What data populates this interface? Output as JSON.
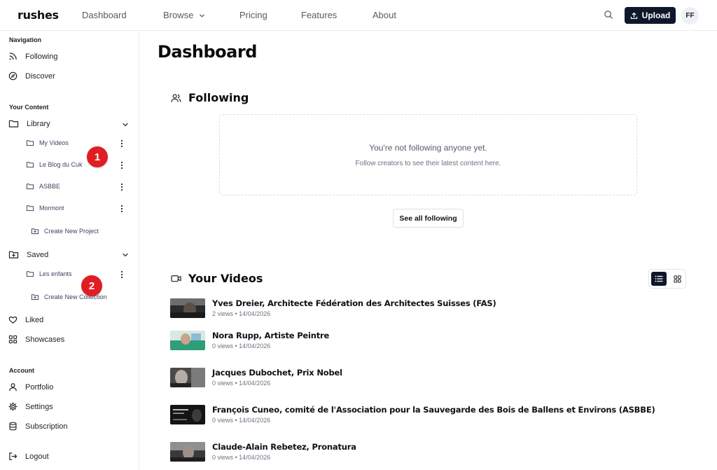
{
  "topbar": {
    "logo": "rushes",
    "nav": [
      "Dashboard",
      "Browse",
      "Pricing",
      "Features",
      "About"
    ],
    "upload_label": "Upload",
    "avatar_initials": "FF"
  },
  "sidebar": {
    "navigation_label": "Navigation",
    "navigation_items": [
      "Following",
      "Discover"
    ],
    "content_label": "Your Content",
    "library_label": "Library",
    "library_items": [
      "My Videos",
      "Le Blog du Cuk",
      "ASBBE",
      "Mormont"
    ],
    "create_project_label": "Create New Project",
    "saved_label": "Saved",
    "saved_items": [
      "Les enfants"
    ],
    "create_collection_label": "Create New Collection",
    "liked_label": "Liked",
    "showcases_label": "Showcases",
    "account_label": "Account",
    "account_items": [
      "Portfolio",
      "Settings",
      "Subscription"
    ],
    "logout_label": "Logout",
    "badges": [
      "1",
      "2"
    ]
  },
  "main": {
    "title": "Dashboard",
    "following": {
      "title": "Following",
      "empty_title": "You're not following anyone yet.",
      "empty_sub": "Follow creators to see their latest content here.",
      "see_all_label": "See all following"
    },
    "videos": {
      "title": "Your Videos",
      "items": [
        {
          "title": "Yves Dreier, Architecte Fédération des Architectes Suisses (FAS)",
          "meta": "2 views • 14/04/2026"
        },
        {
          "title": "Nora Rupp, Artiste Peintre",
          "meta": "0 views • 14/04/2026"
        },
        {
          "title": "Jacques Dubochet, Prix Nobel",
          "meta": "0 views • 14/04/2026"
        },
        {
          "title": "François Cuneo, comité de l'Association pour la Sauvegarde des Bois de Ballens et Environs (ASBBE)",
          "meta": "0 views • 14/04/2026"
        },
        {
          "title": "Claude-Alain Rebetez, Pronatura",
          "meta": "0 views • 14/04/2026"
        }
      ]
    }
  },
  "colors": {
    "primary_dark": "#0f172a",
    "badge_red": "#e11d24"
  }
}
